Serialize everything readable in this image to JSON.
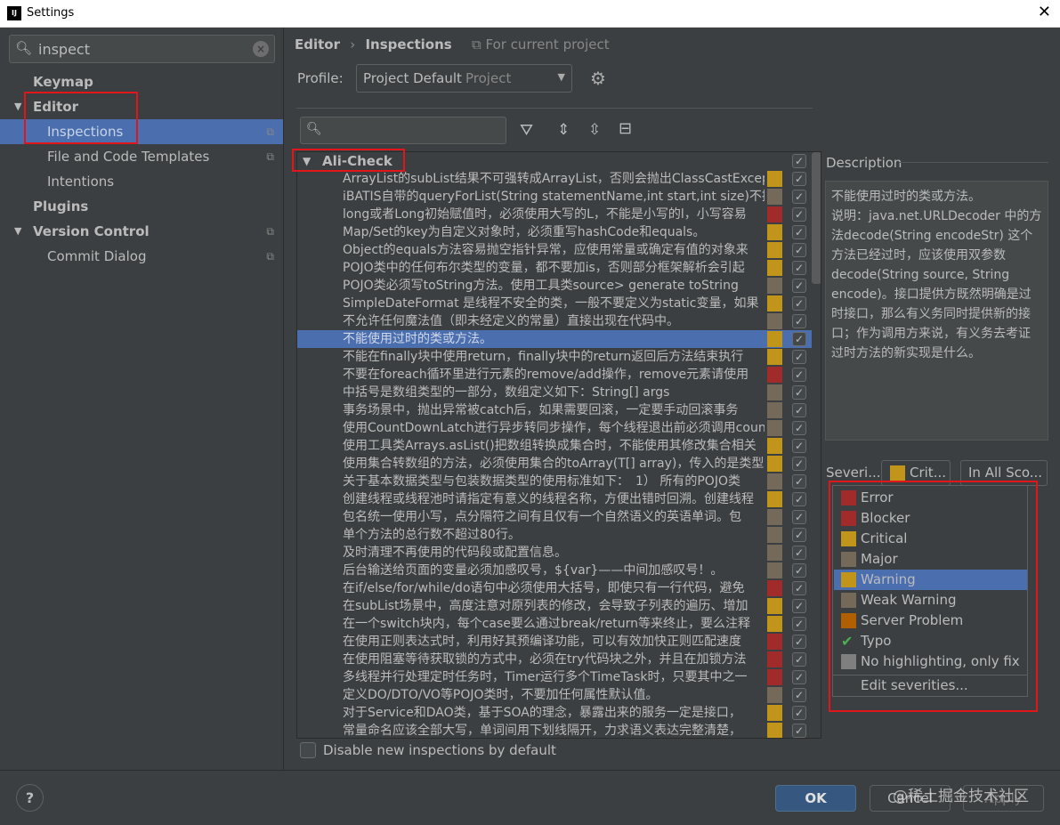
{
  "window": {
    "title": "Settings",
    "close": "✕"
  },
  "colors": {
    "accent": "#4b6eaf",
    "error": "#a12a2a",
    "blocker": "#a12a2a",
    "critical": "#c0951a",
    "major": "#75695a",
    "warning": "#c0951a",
    "weak_warning": "#75695a",
    "server_problem": "#b06000",
    "no_highlighting": "#7f7f7f",
    "typo": "#4caf50"
  },
  "sidebar": {
    "search_value": "inspect",
    "items": [
      {
        "label": "Keymap",
        "bold": true
      },
      {
        "label": "Editor",
        "bold": true,
        "expanded": true
      },
      {
        "label": "Inspections",
        "selected": true,
        "copy": true
      },
      {
        "label": "File and Code Templates",
        "copy": true
      },
      {
        "label": "Intentions"
      },
      {
        "label": "Plugins",
        "bold": true
      },
      {
        "label": "Version Control",
        "bold": true,
        "expanded": true,
        "copy": true
      },
      {
        "label": "Commit Dialog",
        "copy": true
      }
    ]
  },
  "header": {
    "breadcrumb": [
      "Editor",
      "Inspections"
    ],
    "scope_note": "For current project",
    "profile_label": "Profile:",
    "profile_value": "Project Default",
    "profile_type": "Project"
  },
  "tree": {
    "group": "Ali-Check",
    "rows": [
      {
        "text": "ArrayList的subList结果不可强转成ArrayList，否则会抛出ClassCastException",
        "sev": "critical"
      },
      {
        "text": "iBATIS自带的queryForList(String statementName,int start,int size)不推荐使用",
        "sev": "major"
      },
      {
        "text": "long或者Long初始赋值时，必须使用大写的L，不能是小写的l，小写容易",
        "sev": "blocker"
      },
      {
        "text": "Map/Set的key为自定义对象时，必须重写hashCode和equals。",
        "sev": "critical"
      },
      {
        "text": "Object的equals方法容易抛空指针异常，应使用常量或确定有值的对象来",
        "sev": "critical"
      },
      {
        "text": "POJO类中的任何布尔类型的变量，都不要加is，否则部分框架解析会引起",
        "sev": "critical"
      },
      {
        "text": "POJO类必须写toString方法。使用工具类source> generate toString",
        "sev": "major"
      },
      {
        "text": "SimpleDateFormat 是线程不安全的类，一般不要定义为static变量，如果",
        "sev": "critical"
      },
      {
        "text": "不允许任何魔法值（即未经定义的常量）直接出现在代码中。",
        "sev": "major"
      },
      {
        "text": "不能使用过时的类或方法。",
        "sev": "critical",
        "selected": true
      },
      {
        "text": "不能在finally块中使用return，finally块中的return返回后方法结束执行",
        "sev": "critical"
      },
      {
        "text": "不要在foreach循环里进行元素的remove/add操作，remove元素请使用",
        "sev": "blocker"
      },
      {
        "text": "中括号是数组类型的一部分，数组定义如下：String[] args",
        "sev": "major"
      },
      {
        "text": "事务场景中，抛出异常被catch后，如果需要回滚，一定要手动回滚事务",
        "sev": "major"
      },
      {
        "text": "使用CountDownLatch进行异步转同步操作，每个线程退出前必须调用countDown",
        "sev": "major"
      },
      {
        "text": "使用工具类Arrays.asList()把数组转换成集合时，不能使用其修改集合相关",
        "sev": "critical"
      },
      {
        "text": "使用集合转数组的方法，必须使用集合的toArray(T[] array)，传入的是类型",
        "sev": "critical"
      },
      {
        "text": "关于基本数据类型与包装数据类型的使用标准如下：　1） 所有的POJO类",
        "sev": "major"
      },
      {
        "text": "创建线程或线程池时请指定有意义的线程名称，方便出错时回溯。创建线程",
        "sev": "critical"
      },
      {
        "text": "包名统一使用小写，点分隔符之间有且仅有一个自然语义的英语单词。包",
        "sev": "major"
      },
      {
        "text": "单个方法的总行数不超过80行。",
        "sev": "major"
      },
      {
        "text": "及时清理不再使用的代码段或配置信息。",
        "sev": "major"
      },
      {
        "text": "后台输送给页面的变量必须加感叹号，${var}——中间加感叹号！。",
        "sev": "major"
      },
      {
        "text": "在if/else/for/while/do语句中必须使用大括号，即使只有一行代码，避免",
        "sev": "blocker"
      },
      {
        "text": "在subList场景中，高度注意对原列表的修改，会导致子列表的遍历、增加",
        "sev": "critical"
      },
      {
        "text": "在一个switch块内，每个case要么通过break/return等来终止，要么注释",
        "sev": "critical"
      },
      {
        "text": "在使用正则表达式时，利用好其预编译功能，可以有效加快正则匹配速度",
        "sev": "blocker"
      },
      {
        "text": "在使用阻塞等待获取锁的方式中，必须在try代码块之外，并且在加锁方法",
        "sev": "blocker"
      },
      {
        "text": "多线程并行处理定时任务时，Timer运行多个TimeTask时，只要其中之一",
        "sev": "blocker"
      },
      {
        "text": "定义DO/DTO/VO等POJO类时，不要加任何属性默认值。",
        "sev": "major"
      },
      {
        "text": "对于Service和DAO类，基于SOA的理念，暴露出来的服务一定是接口，",
        "sev": "critical"
      },
      {
        "text": "常量命名应该全部大写，单词间用下划线隔开，力求语义表达完整清楚，",
        "sev": "critical"
      }
    ]
  },
  "description": {
    "label": "Description",
    "text": "不能使用过时的类或方法。\n说明：java.net.URLDecoder 中的方法decode(String encodeStr) 这个方法已经过时，应该使用双参数decode(String source, String encode)。接口提供方既然明确是过时接口，那么有义务同时提供新的接口；作为调用方来说，有义务去考证过时方法的新实现是什么。"
  },
  "severity": {
    "label": "Severi...",
    "value": "Crit...",
    "scope": "In All Sco...",
    "options": [
      {
        "label": "Error",
        "color": "#a12a2a"
      },
      {
        "label": "Blocker",
        "color": "#a12a2a"
      },
      {
        "label": "Critical",
        "color": "#c0951a"
      },
      {
        "label": "Major",
        "color": "#75695a"
      },
      {
        "label": "Warning",
        "color": "#c0951a",
        "selected": true
      },
      {
        "label": "Weak Warning",
        "color": "#75695a"
      },
      {
        "label": "Server Problem",
        "color": "#b06000"
      },
      {
        "label": "Typo",
        "icon": "typo-check-icon"
      },
      {
        "label": "No highlighting, only fix",
        "color": "#7f7f7f"
      }
    ],
    "edit": "Edit severities..."
  },
  "footer": {
    "disable_new": "Disable new inspections by default",
    "help": "?",
    "ok": "OK",
    "cancel": "Cancel",
    "apply": "Apply",
    "watermark": "@稀土掘金技术社区"
  }
}
